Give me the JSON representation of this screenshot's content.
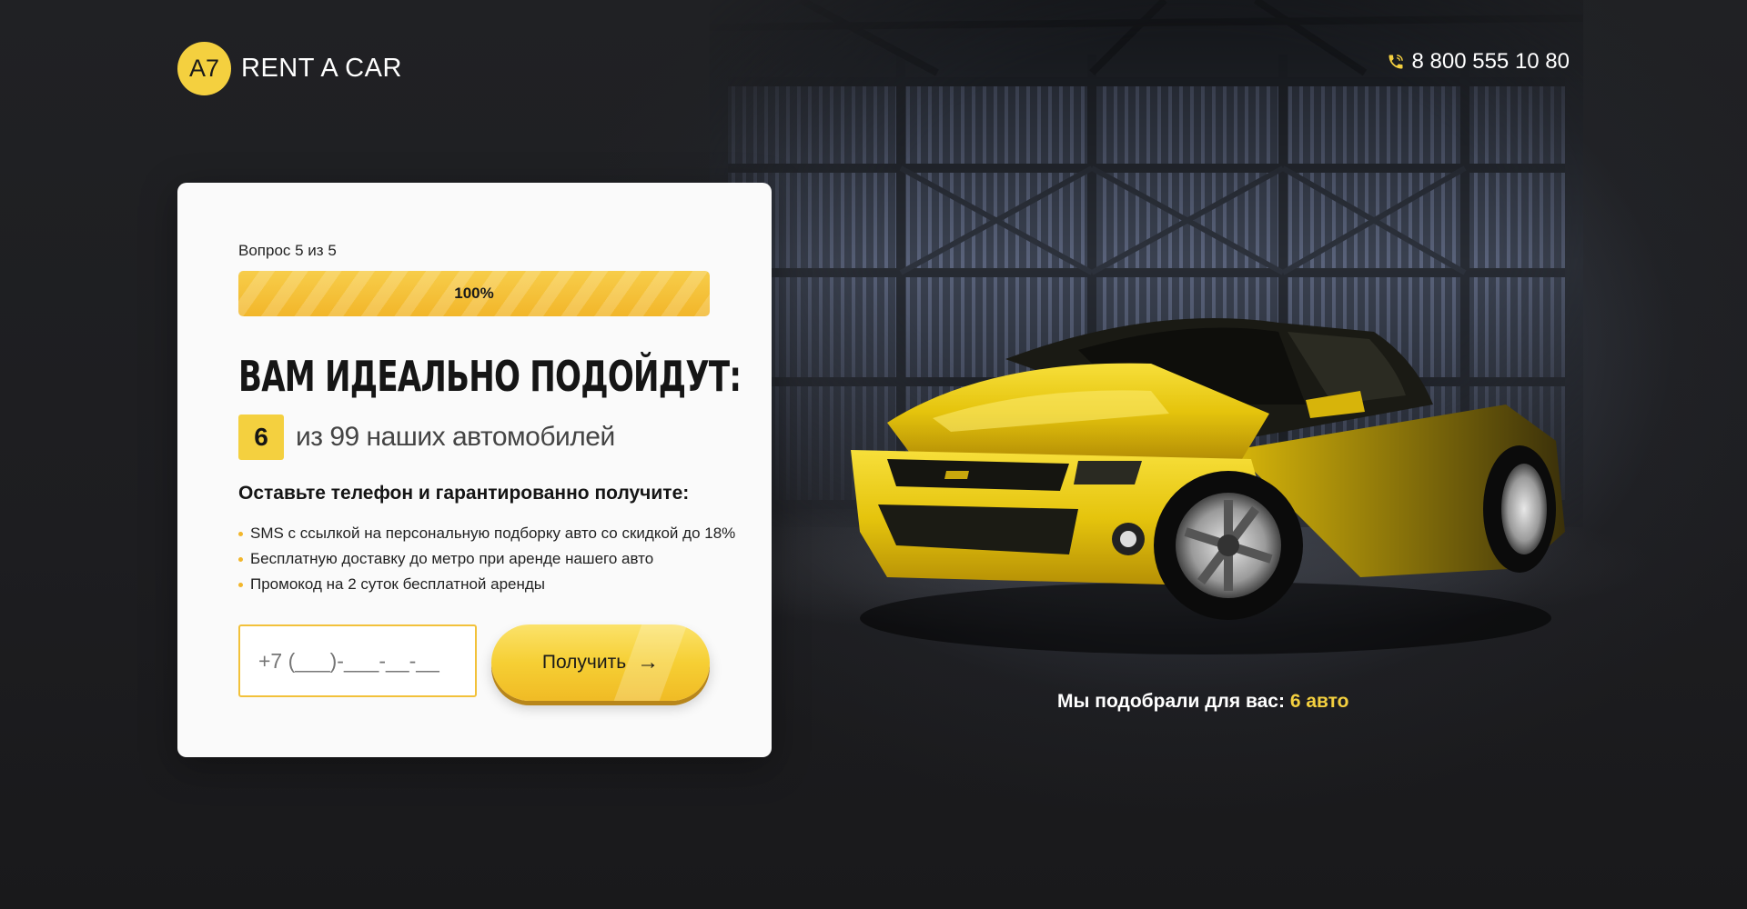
{
  "header": {
    "logo_badge": "A7",
    "logo_text": "RENT A CAR",
    "phone": "8 800 555 10 80"
  },
  "quiz": {
    "progress_label": "Вопрос 5 из 5",
    "progress_percent": 100,
    "progress_text": "100%",
    "headline": "ВАМ ИДЕАЛЬНО ПОДОЙДУТ:",
    "count": "6",
    "count_text": "из 99 наших автомобилей",
    "subheading": "Оставьте телефон и гарантированно получите:",
    "benefits": [
      "SMS с ссылкой на персональную подборку авто со скидкой до 18%",
      "Бесплатную доставку до метро при аренде нашего авто",
      "Промокод на 2 суток бесплатной аренды"
    ],
    "phone_placeholder": "+7 (___)-___-__-__",
    "submit_label": "Получить"
  },
  "result": {
    "label": "Мы подобрали для вас:",
    "count": "6 авто"
  },
  "colors": {
    "accent": "#f4d03f",
    "background": "#1c1c1e",
    "card": "#fafafa"
  },
  "icons": {
    "phone": "phone-icon",
    "arrow": "arrow-right-icon"
  }
}
